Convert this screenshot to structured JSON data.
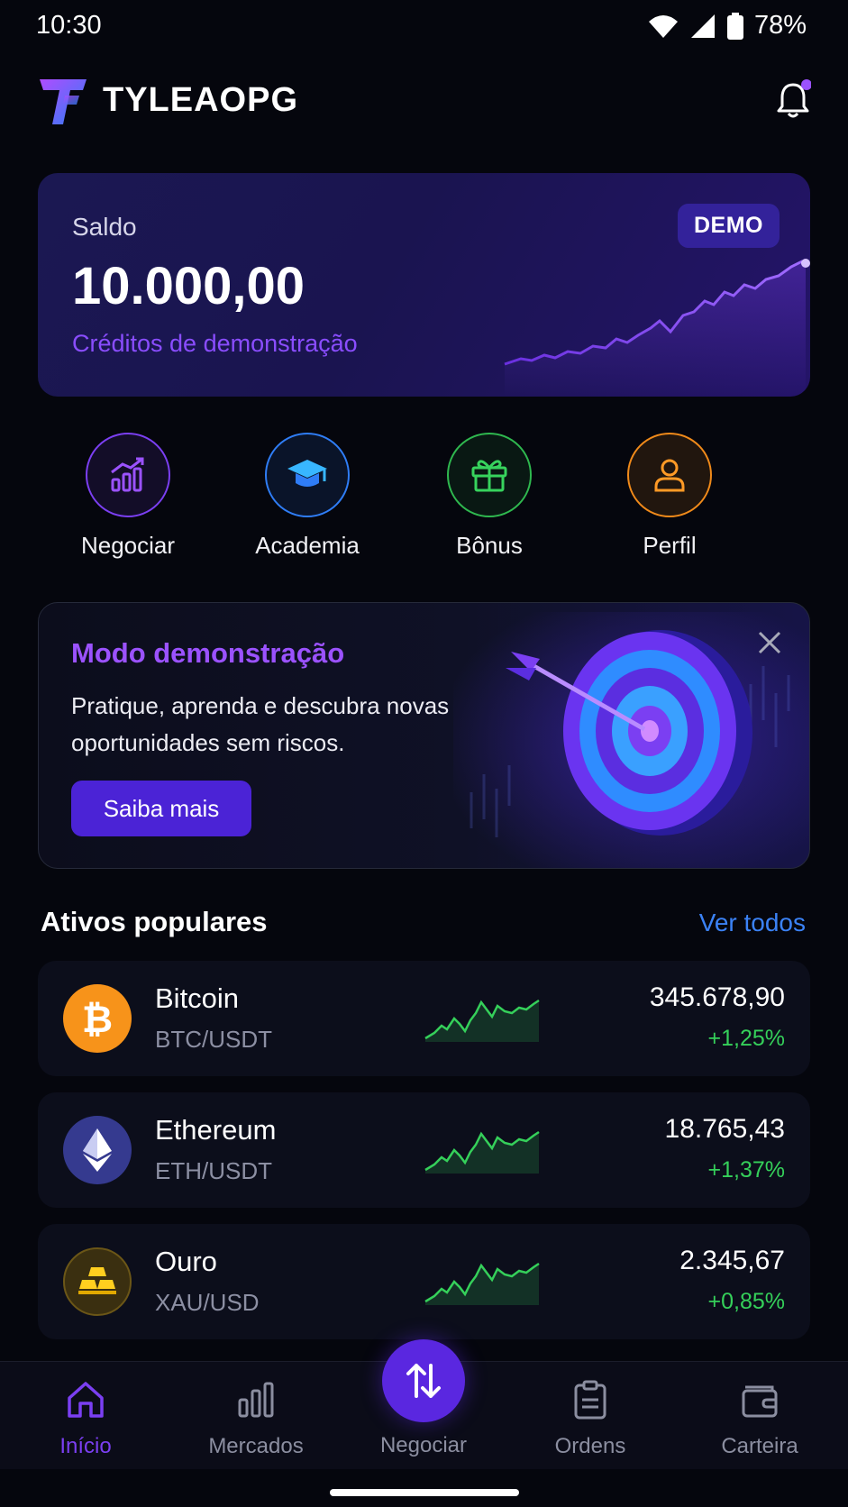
{
  "status": {
    "time": "10:30",
    "battery": "78%"
  },
  "header": {
    "brand": "TYLEAOPG"
  },
  "balance": {
    "label": "Saldo",
    "value": "10.000,00",
    "subtitle": "Créditos de demonstração",
    "badge": "DEMO"
  },
  "actions": [
    {
      "label": "Negociar",
      "icon": "chart-up-icon",
      "color": "#7b3ff2"
    },
    {
      "label": "Academia",
      "icon": "graduation-cap-icon",
      "color": "#2f7df6"
    },
    {
      "label": "Bônus",
      "icon": "gift-icon",
      "color": "#2fb84f"
    },
    {
      "label": "Perfil",
      "icon": "user-icon",
      "color": "#f08a1a"
    }
  ],
  "promo": {
    "title": "Modo demonstração",
    "text": "Pratique, aprenda e descubra novas oportunidades sem riscos.",
    "button": "Saiba mais"
  },
  "popular": {
    "title": "Ativos populares",
    "link": "Ver todos",
    "items": [
      {
        "name": "Bitcoin",
        "pair": "BTC/USDT",
        "price": "345.678,90",
        "change": "+1,25%",
        "icon": "bitcoin-icon",
        "color": "#f7931a"
      },
      {
        "name": "Ethereum",
        "pair": "ETH/USDT",
        "price": "18.765,43",
        "change": "+1,37%",
        "icon": "ethereum-icon",
        "color": "#3a3f9a"
      },
      {
        "name": "Ouro",
        "pair": "XAU/USD",
        "price": "2.345,67",
        "change": "+0,85%",
        "icon": "gold-bars-icon",
        "color": "#3a2f10"
      }
    ]
  },
  "nav": {
    "items": [
      {
        "label": "Início",
        "icon": "home-icon"
      },
      {
        "label": "Mercados",
        "icon": "bar-chart-icon"
      },
      {
        "label": "Negociar",
        "icon": "swap-arrows-icon"
      },
      {
        "label": "Ordens",
        "icon": "clipboard-icon"
      },
      {
        "label": "Carteira",
        "icon": "wallet-icon"
      }
    ]
  },
  "colors": {
    "accent": "#7b3ff2",
    "positive": "#35d05a",
    "link": "#3b82f6"
  }
}
